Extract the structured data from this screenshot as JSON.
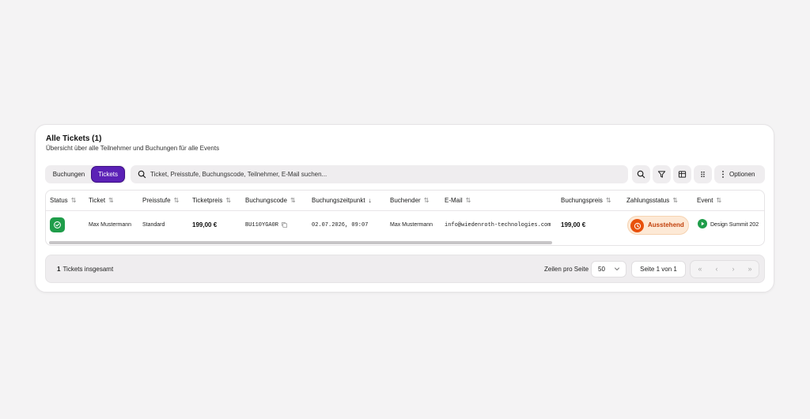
{
  "card": {
    "title": "Alle Tickets (1)",
    "subtitle": "Übersicht über alle Teilnehmer und Buchungen für alle Events"
  },
  "toolbar": {
    "tab_bookings": "Buchungen",
    "tab_tickets": "Tickets",
    "active_tab": "Tickets",
    "search_placeholder": "Ticket, Preisstufe, Buchungscode, Teilnehmer, E-Mail suchen...",
    "options_label": "Optionen",
    "icons": [
      "search-icon",
      "filter-icon",
      "table-icon",
      "grip-icon",
      "more-vertical-icon"
    ]
  },
  "table": {
    "columns": [
      {
        "key": "status",
        "label": "Status",
        "sort": "⇅"
      },
      {
        "key": "ticket",
        "label": "Ticket",
        "sort": "⇅"
      },
      {
        "key": "preisstufe",
        "label": "Preisstufe",
        "sort": "⇅"
      },
      {
        "key": "ticketpreis",
        "label": "Ticketpreis",
        "sort": "⇅"
      },
      {
        "key": "buchungscode",
        "label": "Buchungscode",
        "sort": "⇅"
      },
      {
        "key": "buchungszeitpunkt",
        "label": "Buchungszeitpunkt",
        "sort": "↓"
      },
      {
        "key": "buchender",
        "label": "Buchender",
        "sort": "⇅"
      },
      {
        "key": "email",
        "label": "E-Mail",
        "sort": "⇅"
      },
      {
        "key": "buchungspreis",
        "label": "Buchungspreis",
        "sort": "⇅"
      },
      {
        "key": "zahlungsstatus",
        "label": "Zahlungsstatus",
        "sort": "⇅"
      },
      {
        "key": "event",
        "label": "Event",
        "sort": "⇅"
      }
    ],
    "rows": [
      {
        "status": "check-icon",
        "ticket": "Max Mustermann",
        "preisstufe": "Standard",
        "ticketpreis": "199,00 €",
        "buchungscode": "BU110YGA0R",
        "buchungszeitpunkt": "02.07.2026, 09:07",
        "buchender": "Max Mustermann",
        "email": "info@wiedenroth-technologies.com",
        "buchungspreis": "199,00 €",
        "zahlungsstatus": "Ausstehend",
        "event": "Design Summit 202"
      }
    ]
  },
  "footer": {
    "total_count": "1",
    "total_label": "Tickets insgesamt",
    "rows_per_page_label": "Zeilen pro Seite",
    "rows_per_page_value": "50",
    "page_label": "Seite 1 von 1",
    "pager": {
      "first": "«",
      "prev": "‹",
      "next": "›",
      "last": "»"
    }
  },
  "colors": {
    "accent": "#5b21b6",
    "success": "#1f9d4a",
    "pending": "#e8510c",
    "pending_bg": "#fde9d6"
  }
}
